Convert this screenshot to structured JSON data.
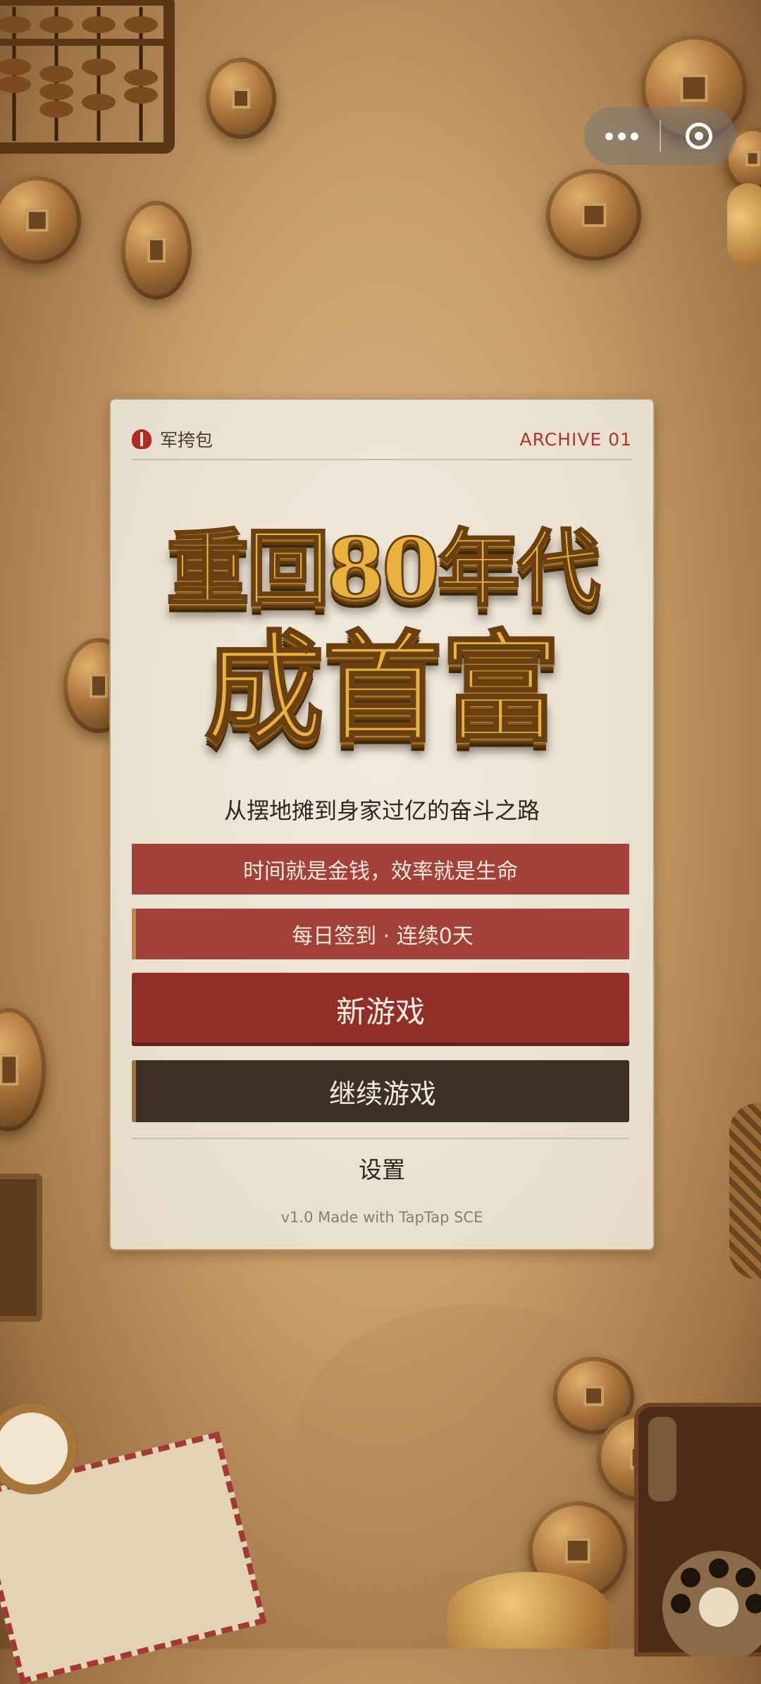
{
  "capsule": {
    "more_icon": "more-dots-icon",
    "close_icon": "target-close-icon"
  },
  "card": {
    "brand_name": "军挎包",
    "archive_label": "ARCHIVE 01",
    "logo": {
      "line1": "重回80年代",
      "line2": "成首富"
    },
    "subtitle": "从摆地摊到身家过亿的奋斗之路",
    "motto": "时间就是金钱，效率就是生命",
    "checkin": "每日签到 · 连续0天",
    "new_game": "新游戏",
    "continue_game": "继续游戏",
    "settings": "设置",
    "footer": "v1.0  Made with TapTap SCE"
  },
  "colors": {
    "accent_red": "#a2413a",
    "primary_red": "#922e28",
    "dark_button": "#3c2f26",
    "gold": "#e9b13e",
    "paper": "#ece3d3"
  }
}
